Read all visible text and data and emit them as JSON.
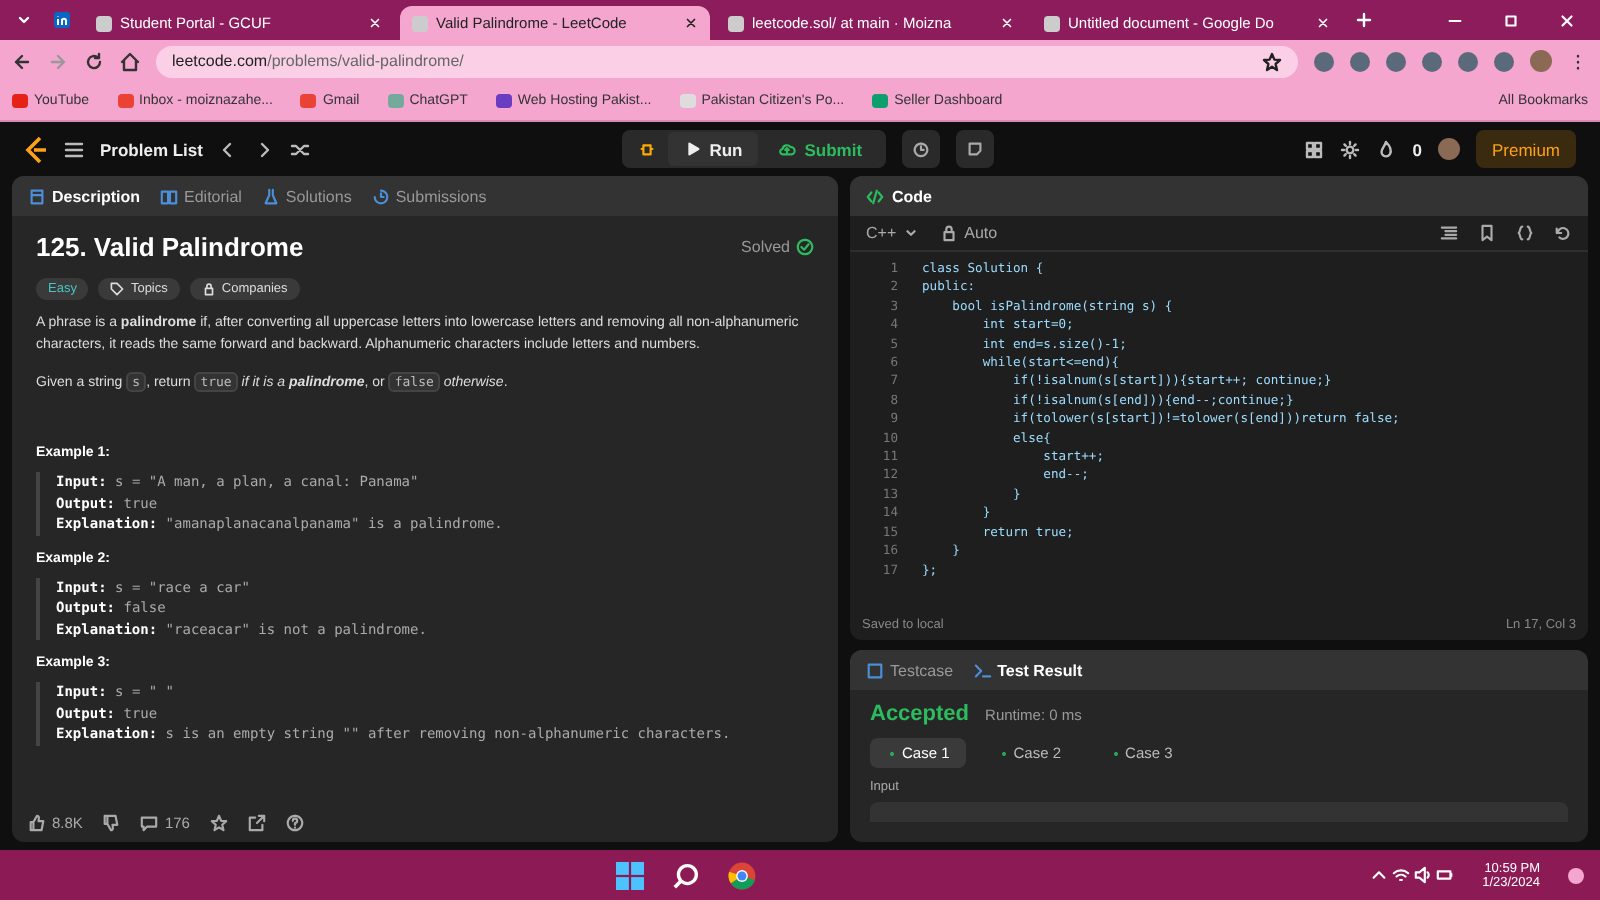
{
  "browser": {
    "tabs": [
      {
        "title": "Student Portal - GCUF",
        "selected": false
      },
      {
        "title": "Valid Palindrome - LeetCode",
        "selected": true
      },
      {
        "title": "leetcode.sol/ at main · Moizna",
        "selected": false
      },
      {
        "title": "Untitled document - Google Do",
        "selected": false
      }
    ],
    "url_host": "leetcode.com",
    "url_path": "/problems/valid-palindrome/",
    "bookmarks": [
      {
        "label": "YouTube",
        "color": "#e62117"
      },
      {
        "label": "Inbox - moiznazahe...",
        "color": "#ea4335"
      },
      {
        "label": "Gmail",
        "color": "#ea4335"
      },
      {
        "label": "ChatGPT",
        "color": "#74aa9c"
      },
      {
        "label": "Web Hosting Pakist...",
        "color": "#6a3cc2"
      },
      {
        "label": "Pakistan Citizen's Po...",
        "color": "#dddddd"
      },
      {
        "label": "Seller Dashboard",
        "color": "#0e9f6e"
      }
    ],
    "all_bookmarks": "All Bookmarks"
  },
  "nav": {
    "problem_list": "Problem List",
    "run": "Run",
    "submit": "Submit",
    "streak": "0",
    "premium": "Premium"
  },
  "left": {
    "tabs": [
      {
        "label": "Description",
        "selected": true
      },
      {
        "label": "Editorial",
        "selected": false
      },
      {
        "label": "Solutions",
        "selected": false
      },
      {
        "label": "Submissions",
        "selected": false
      }
    ],
    "title": "125. Valid Palindrome",
    "status": "Solved",
    "difficulty": "Easy",
    "chips": [
      "Topics",
      "Companies"
    ],
    "paragraph": "A phrase is a **palindrome** if, after converting all uppercase letters into lowercase letters and removing all non-alphanumeric characters, it reads the same forward and backward. Alphanumeric characters include letters and numbers.",
    "given": [
      {
        "kind": "text",
        "text": "Given a string "
      },
      {
        "kind": "code",
        "text": "s"
      },
      {
        "kind": "text",
        "text": ", return "
      },
      {
        "kind": "code",
        "text": "true"
      },
      {
        "kind": "emph",
        "text": " if it is a **palindrome**"
      },
      {
        "kind": "text",
        "text": ", or "
      },
      {
        "kind": "code",
        "text": "false"
      },
      {
        "kind": "emph",
        "text": " otherwise"
      },
      {
        "kind": "text",
        "text": "."
      }
    ],
    "examples": [
      {
        "title": "Example 1:",
        "lines": [
          {
            "label": "Input:",
            "value": "s = \"A man, a plan, a canal: Panama\""
          },
          {
            "label": "Output:",
            "value": "true"
          },
          {
            "label": "Explanation:",
            "value": "\"amanaplanacanalpanama\" is a palindrome."
          }
        ]
      },
      {
        "title": "Example 2:",
        "lines": [
          {
            "label": "Input:",
            "value": "s = \"race a car\""
          },
          {
            "label": "Output:",
            "value": "false"
          },
          {
            "label": "Explanation:",
            "value": "\"raceacar\" is not a palindrome."
          }
        ]
      },
      {
        "title": "Example 3:",
        "lines": [
          {
            "label": "Input:",
            "value": "s = \" \""
          },
          {
            "label": "Output:",
            "value": "true"
          },
          {
            "label": "Explanation:",
            "value": "s is an empty string \"\" after removing non-alphanumeric characters."
          }
        ]
      }
    ],
    "likes": "8.8K",
    "comments": "176"
  },
  "code": {
    "title": "Code",
    "language": "C++",
    "mode": "Auto",
    "lines": [
      "class Solution {",
      "public:",
      "    bool isPalindrome(string s) {",
      "        int start=0;",
      "        int end=s.size()-1;",
      "        while(start<=end){",
      "            if(!isalnum(s[start])){start++; continue;}",
      "            if(!isalnum(s[end])){end--;continue;}",
      "            if(tolower(s[start])!=tolower(s[end]))return false;",
      "            else{",
      "                start++;",
      "                end--;",
      "            }",
      "        }",
      "        return true;",
      "    }",
      "};"
    ],
    "line_numbers": [
      "1",
      "2",
      "3",
      "4",
      "5",
      "6",
      "7",
      "8",
      "9",
      "10",
      "11",
      "12",
      "13",
      "14",
      "15",
      "16",
      "17"
    ],
    "saved": "Saved to local",
    "cursor": "Ln 17, Col 3"
  },
  "result": {
    "tabs": [
      {
        "label": "Testcase",
        "selected": false
      },
      {
        "label": "Test Result",
        "selected": true
      }
    ],
    "verdict": "Accepted",
    "runtime": "Runtime: 0 ms",
    "cases": [
      {
        "label": "Case 1",
        "selected": true
      },
      {
        "label": "Case 2",
        "selected": false
      },
      {
        "label": "Case 3",
        "selected": false
      }
    ],
    "input_label": "Input"
  },
  "taskbar": {
    "time": "10:59 PM",
    "date": "1/23/2024"
  }
}
